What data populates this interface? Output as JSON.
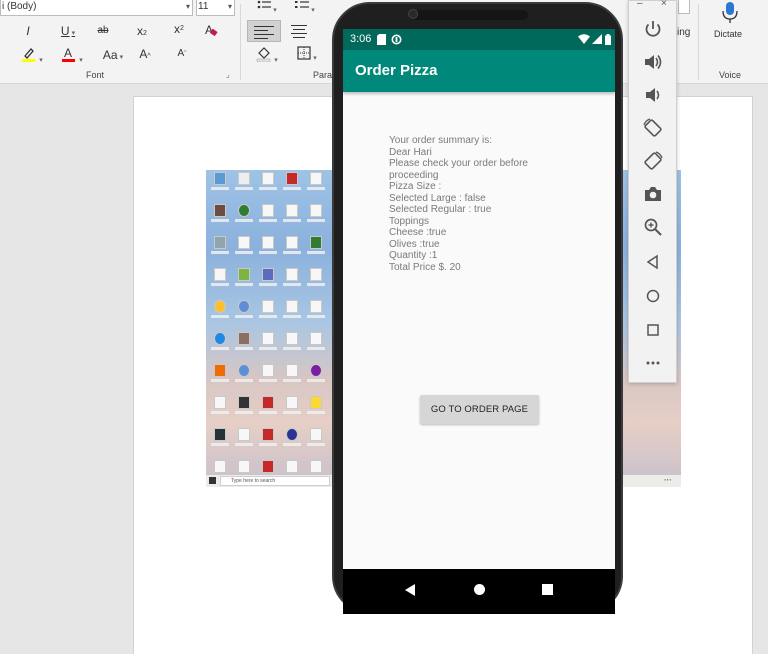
{
  "ribbon": {
    "font_name": "i (Body)",
    "font_size": "11",
    "font_group_label": "Font",
    "paragraph_group_label": "Para",
    "voice_group_label": "Voice",
    "dictate_label": "Dictate",
    "truncated_label": "ing",
    "buttons": {
      "italic": "I",
      "underline": "U",
      "strikethrough": "ab",
      "subscript": "x",
      "subscript_mark": "2",
      "superscript": "x",
      "superscript_mark": "2",
      "grow_font": "A",
      "shrink_font": "A",
      "change_case": "Aa"
    },
    "colors": {
      "highlight": "#ffff00",
      "font_color": "#ff0000"
    }
  },
  "phone": {
    "status": {
      "time": "3:06"
    },
    "app_title": "Order Pizza",
    "summary_lines": [
      "Your order summary is:",
      "Dear Hari",
      "Please check your order before",
      "proceeding",
      "Pizza Size :",
      "Selected Large : false",
      "Selected Regular : true",
      "Toppings",
      "Cheese :true",
      "Olives :true",
      "Quantity :1",
      "Total Price $. 20"
    ],
    "button_label": "GO TO ORDER PAGE",
    "colors": {
      "status_bar": "#00695c",
      "app_bar": "#00897b",
      "summary_text": "#7a7a7a"
    }
  },
  "emulator_toolbar": {
    "tools": [
      "power-icon",
      "volume-up-icon",
      "volume-down-icon",
      "rotate-left-icon",
      "rotate-right-icon",
      "camera-icon",
      "zoom-icon",
      "back-icon",
      "home-icon",
      "overview-icon",
      "more-icon"
    ]
  },
  "taskbar": {
    "search_placeholder": "Type here to search"
  }
}
